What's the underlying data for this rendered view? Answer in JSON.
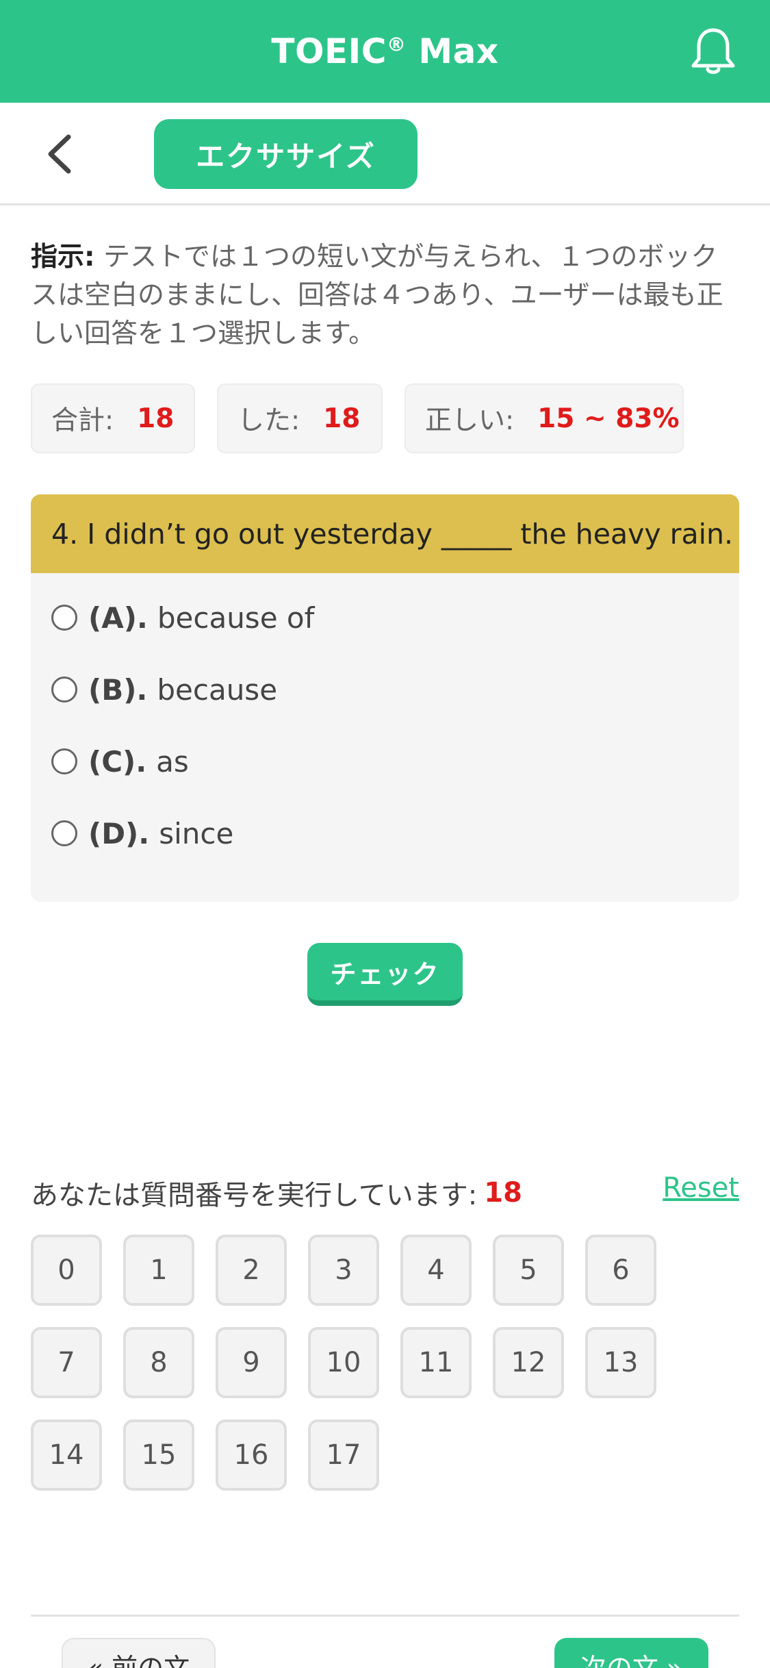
{
  "header": {
    "title": "TOEIC",
    "registered": "®",
    "title_suffix": " Max",
    "bell_icon": "bell-icon"
  },
  "subbar": {
    "back_icon": "chevron-left-icon",
    "tab_label": "エクササイズ"
  },
  "instructions": {
    "label": "指示:",
    "text": " テストでは１つの短い文が与えられ、１つのボックスは空白のままにし、回答は４つあり、ユーザーは最も正しい回答を１つ選択します。"
  },
  "stats": {
    "total_label": "合計:",
    "total_value": "18",
    "done_label": "した:",
    "done_value": "18",
    "correct_label": "正しい:",
    "correct_value": "15 ~ 83%"
  },
  "question": {
    "text": "4. I didn’t go out yesterday _____ the heavy rain.",
    "options": [
      {
        "letter": "(A).",
        "text": "because of"
      },
      {
        "letter": "(B).",
        "text": "because"
      },
      {
        "letter": "(C).",
        "text": "as"
      },
      {
        "letter": "(D).",
        "text": "since"
      }
    ]
  },
  "check_button": "チェック",
  "progress": {
    "label": "あなたは質問番号を実行しています:",
    "current": "18",
    "reset": "Reset"
  },
  "numbers": [
    "0",
    "1",
    "2",
    "3",
    "4",
    "5",
    "6",
    "7",
    "8",
    "9",
    "10",
    "11",
    "12",
    "13",
    "14",
    "15",
    "16",
    "17"
  ],
  "nav": {
    "prev": "« 前の文",
    "next": "次の文 »"
  },
  "colors": {
    "accent": "#2dc48a",
    "question_header": "#dcbf4e",
    "highlight": "#e01b1b"
  }
}
